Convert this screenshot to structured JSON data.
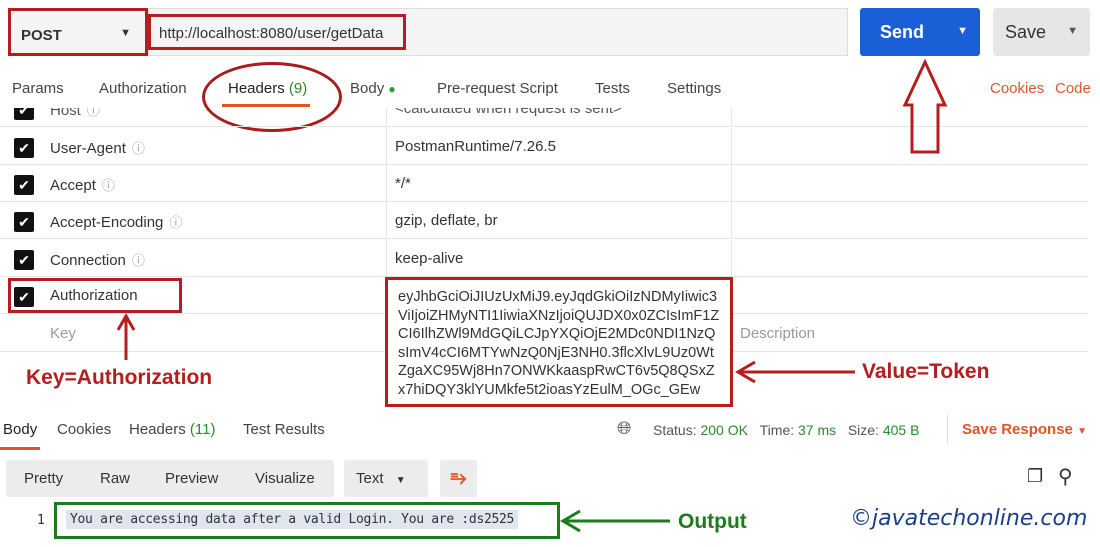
{
  "request": {
    "method": "POST",
    "url": "http://localhost:8080/user/getData",
    "send_label": "Send",
    "save_label": "Save"
  },
  "tabs": [
    {
      "label": "Params"
    },
    {
      "label": "Authorization"
    },
    {
      "label": "Headers",
      "count": "(9)"
    },
    {
      "label": "Body"
    },
    {
      "label": "Pre-request Script"
    },
    {
      "label": "Tests"
    },
    {
      "label": "Settings"
    }
  ],
  "links": {
    "cookies": "Cookies",
    "code": "Code"
  },
  "headers": [
    {
      "key": "Host",
      "value": "<calculated when request is sent>",
      "checked": true
    },
    {
      "key": "User-Agent",
      "value": "PostmanRuntime/7.26.5",
      "checked": true
    },
    {
      "key": "Accept",
      "value": "*/*",
      "checked": true
    },
    {
      "key": "Accept-Encoding",
      "value": "gzip, deflate, br",
      "checked": true
    },
    {
      "key": "Connection",
      "value": "keep-alive",
      "checked": true
    },
    {
      "key": "Authorization",
      "value": "eyJhbGciOiJIUzUxMiJ9.eyJqdGkiOiIzNDMyIiwic3ViIjoiZHMyNTI1IiwiaXNzIjoiQUJDX0x0ZCIsImF1ZCI6IlhZWl9MdGQiLCJpYXQiOjE2MDc0NDI1NzQsImV4cCI6MTYwNzQ0NjE3NH0.3flcXlvL9Uz0WtZgaXC95Wj8Hn7ONWKkaaspRwCT6v5Q8QSxZx7hiDQY3klYUMkfe5t2ioasYzEulM_OGc_GEw",
      "checked": true
    }
  ],
  "new_row": {
    "key_placeholder": "Key",
    "description_placeholder": "Description"
  },
  "annotations": {
    "key": "Key=Authorization",
    "value": "Value=Token",
    "output": "Output",
    "watermark": "©javatechonline.com"
  },
  "response": {
    "tabs": [
      {
        "label": "Body"
      },
      {
        "label": "Cookies"
      },
      {
        "label": "Headers",
        "count": "(11)"
      },
      {
        "label": "Test Results"
      }
    ],
    "status_label": "Status:",
    "status": "200 OK",
    "time_label": "Time:",
    "time": "37 ms",
    "size_label": "Size:",
    "size": "405 B",
    "save_response": "Save Response",
    "views": [
      "Pretty",
      "Raw",
      "Preview",
      "Visualize"
    ],
    "format": "Text",
    "line_number": "1",
    "output": "You are accessing data after a valid Login. You are :ds2525"
  },
  "colors": {
    "send": "#1a5fd6",
    "accent": "#e0542c",
    "annotation_red": "#b41e1e",
    "annotation_green": "#1e7a1e"
  }
}
